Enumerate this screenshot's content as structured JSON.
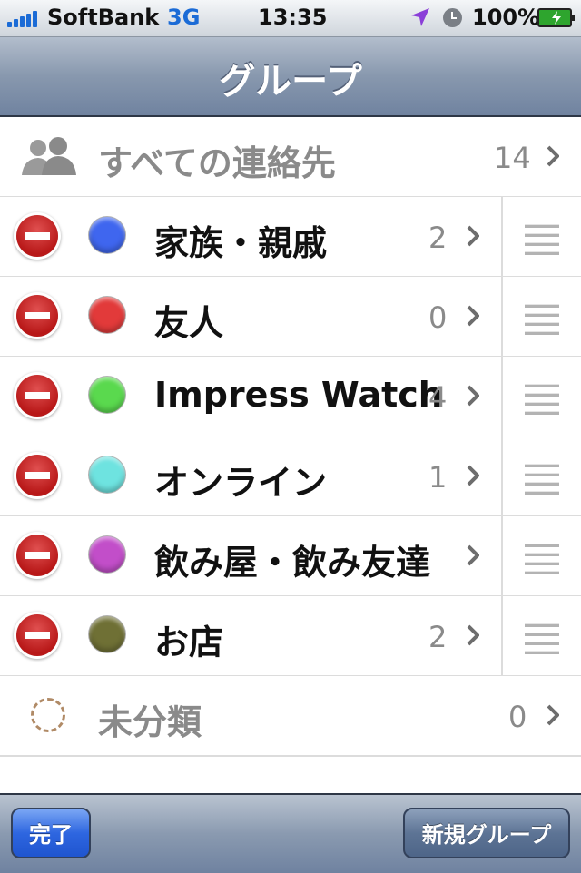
{
  "status_bar": {
    "carrier": "SoftBank",
    "network": "3G",
    "time": "13:35",
    "battery": "100%",
    "signal_bars": 5,
    "icons": [
      "location-arrow-icon",
      "alarm-clock-icon",
      "battery-charging-icon"
    ]
  },
  "nav": {
    "title": "グループ"
  },
  "all_contacts": {
    "label": "すべての連絡先",
    "count": "14"
  },
  "groups": [
    {
      "label": "家族・親戚",
      "count": "2",
      "color": "#3f66ef"
    },
    {
      "label": "友人",
      "count": "0",
      "color": "#e23a3a"
    },
    {
      "label": "Impress Watch",
      "count": "4",
      "color": "#5ad94e"
    },
    {
      "label": "オンライン",
      "count": "1",
      "color": "#6ee3e0"
    },
    {
      "label": "飲み屋・飲み友達",
      "count": "",
      "color": "#c24ec9"
    },
    {
      "label": "お店",
      "count": "2",
      "color": "#6f7035"
    }
  ],
  "uncategorized": {
    "label": "未分類",
    "count": "0"
  },
  "toolbar": {
    "done_label": "完了",
    "new_group_label": "新規グループ"
  },
  "colors": {
    "accent_blue": "#2e66e0",
    "nav_bar": "#8898ae",
    "delete_red": "#c41e1e"
  }
}
